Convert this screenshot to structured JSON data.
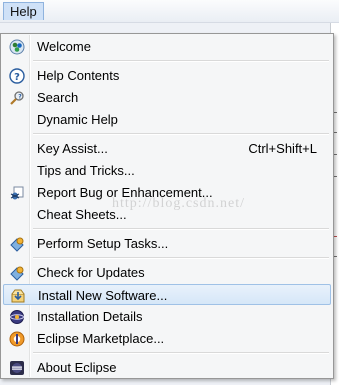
{
  "menubar": {
    "help": "Help"
  },
  "menu": {
    "items": [
      {
        "label": "Welcome",
        "icon": "welcome-icon"
      },
      {
        "label": "Help Contents",
        "icon": "help-contents-icon"
      },
      {
        "label": "Search",
        "icon": "search-icon"
      },
      {
        "label": "Dynamic Help"
      },
      {
        "label": "Key Assist...",
        "shortcut": "Ctrl+Shift+L"
      },
      {
        "label": "Tips and Tricks..."
      },
      {
        "label": "Report Bug or Enhancement...",
        "icon": "report-bug-icon"
      },
      {
        "label": "Cheat Sheets..."
      },
      {
        "label": "Perform Setup Tasks...",
        "icon": "setup-tasks-icon"
      },
      {
        "label": "Check for Updates",
        "icon": "update-icon"
      },
      {
        "label": "Install New Software...",
        "icon": "install-software-icon",
        "selected": true
      },
      {
        "label": "Installation Details",
        "icon": "installation-details-icon"
      },
      {
        "label": "Eclipse Marketplace...",
        "icon": "marketplace-icon"
      },
      {
        "label": "About Eclipse",
        "icon": "eclipse-icon"
      }
    ]
  },
  "watermark": "http://blog.csdn.net/"
}
